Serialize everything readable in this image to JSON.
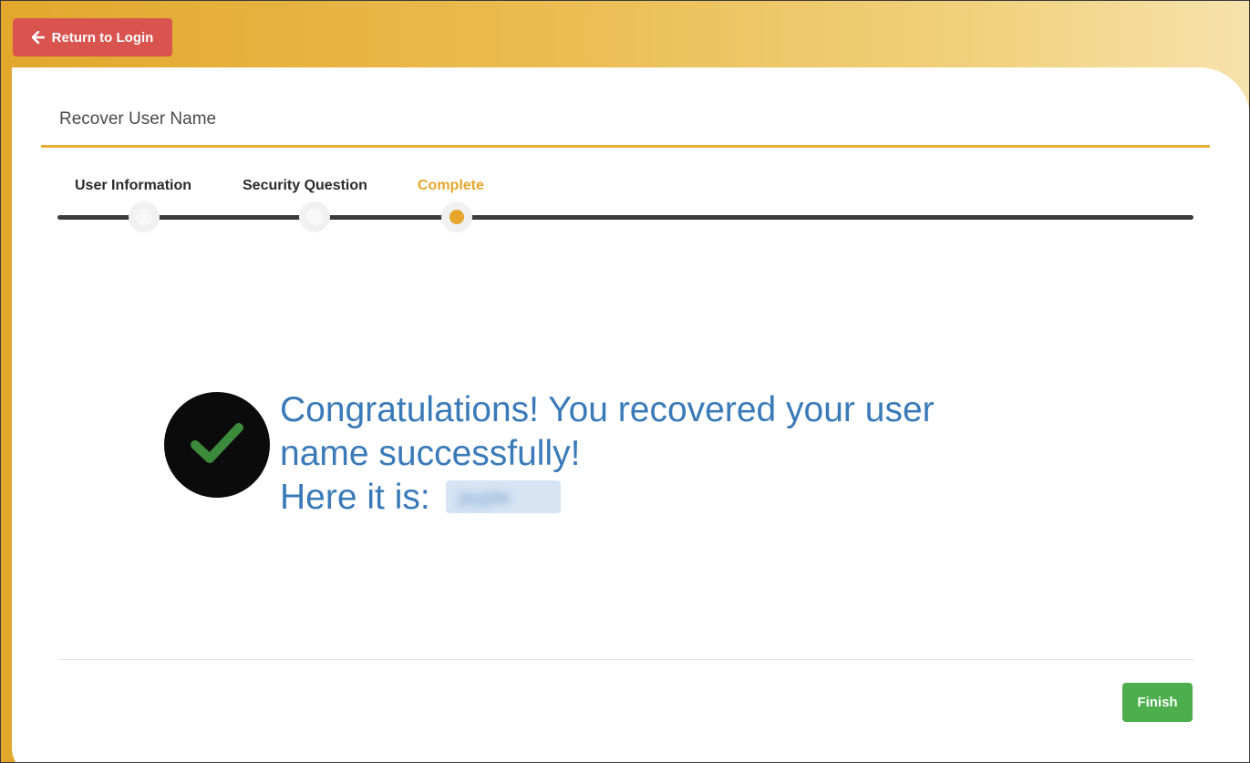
{
  "header": {
    "back_label": "Return to Login",
    "back_icon": "arrow-left-icon"
  },
  "page": {
    "title": "Recover User Name"
  },
  "steps": [
    {
      "label": "User Information",
      "state": "done"
    },
    {
      "label": "Security Question",
      "state": "done"
    },
    {
      "label": "Complete",
      "state": "active"
    }
  ],
  "result": {
    "icon": "checkmark-icon",
    "line1": "Congratulations! You recovered your user",
    "line2": "name successfully!",
    "line3_prefix": "Here it is:",
    "username": "jayple",
    "username_obscured": true
  },
  "footer": {
    "finish_label": "Finish"
  },
  "colors": {
    "accent": "#e6a62c",
    "danger": "#d9534f",
    "success": "#4cae4c",
    "message": "#3a7ab8",
    "check_bg": "#0b0b0b",
    "check_mark": "#3c8a3c"
  }
}
